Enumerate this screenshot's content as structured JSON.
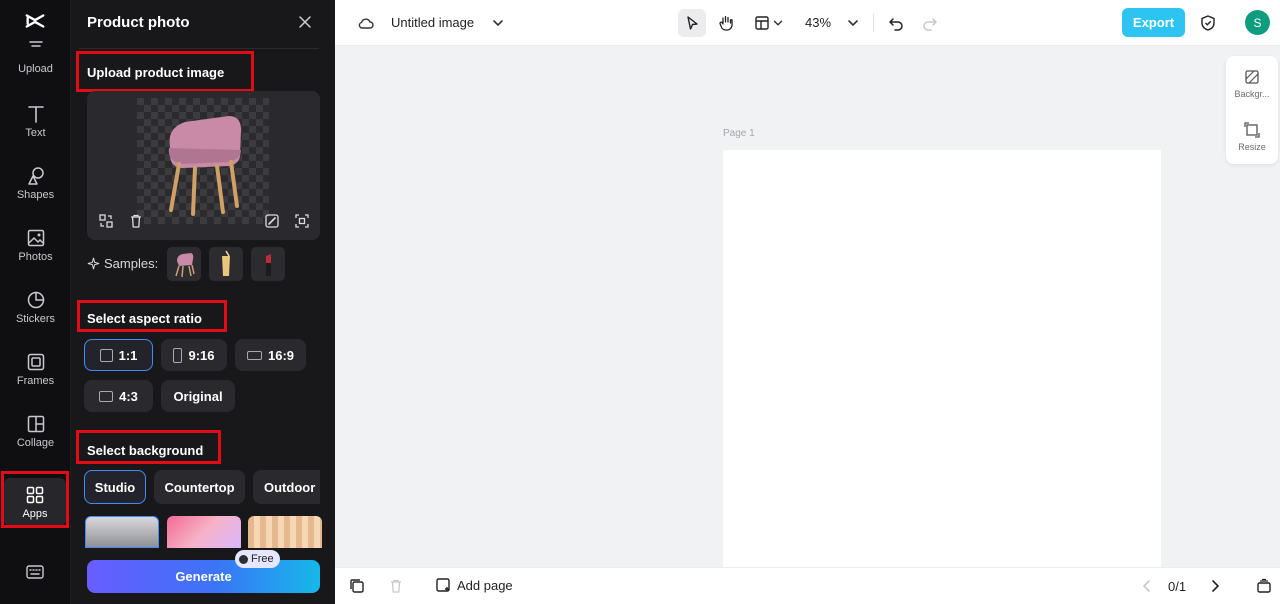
{
  "rail": {
    "items": [
      {
        "label": "Upload",
        "icon": "upload-icon"
      },
      {
        "label": "Text",
        "icon": "text-icon"
      },
      {
        "label": "Shapes",
        "icon": "shapes-icon"
      },
      {
        "label": "Photos",
        "icon": "photos-icon"
      },
      {
        "label": "Stickers",
        "icon": "stickers-icon"
      },
      {
        "label": "Frames",
        "icon": "frames-icon"
      },
      {
        "label": "Collage",
        "icon": "collage-icon"
      },
      {
        "label": "Apps",
        "icon": "apps-icon"
      }
    ],
    "active": "Apps"
  },
  "panel": {
    "title": "Product photo",
    "upload_label": "Upload product image",
    "samples_label": "Samples:",
    "aspect_label": "Select aspect ratio",
    "aspect_options": [
      "1:1",
      "9:16",
      "16:9",
      "4:3",
      "Original"
    ],
    "aspect_selected": "1:1",
    "background_label": "Select background",
    "background_tabs": [
      "Studio",
      "Countertop",
      "Outdoor"
    ],
    "background_selected": "Studio",
    "generate_label": "Generate",
    "free_badge": "Free"
  },
  "topbar": {
    "doc_title": "Untitled image",
    "zoom": "43%",
    "export_label": "Export",
    "avatar_initial": "S"
  },
  "canvas": {
    "page_label": "Page 1"
  },
  "side_tools": [
    {
      "label": "Backgr...",
      "icon": "background-icon"
    },
    {
      "label": "Resize",
      "icon": "resize-icon"
    }
  ],
  "bottombar": {
    "add_page_label": "Add page",
    "page_count": "0/1"
  },
  "colors": {
    "highlight": "#e30b17",
    "export": "#2ec4f1",
    "selected_outline": "#3f8cff",
    "avatar": "#0e9c7e"
  }
}
